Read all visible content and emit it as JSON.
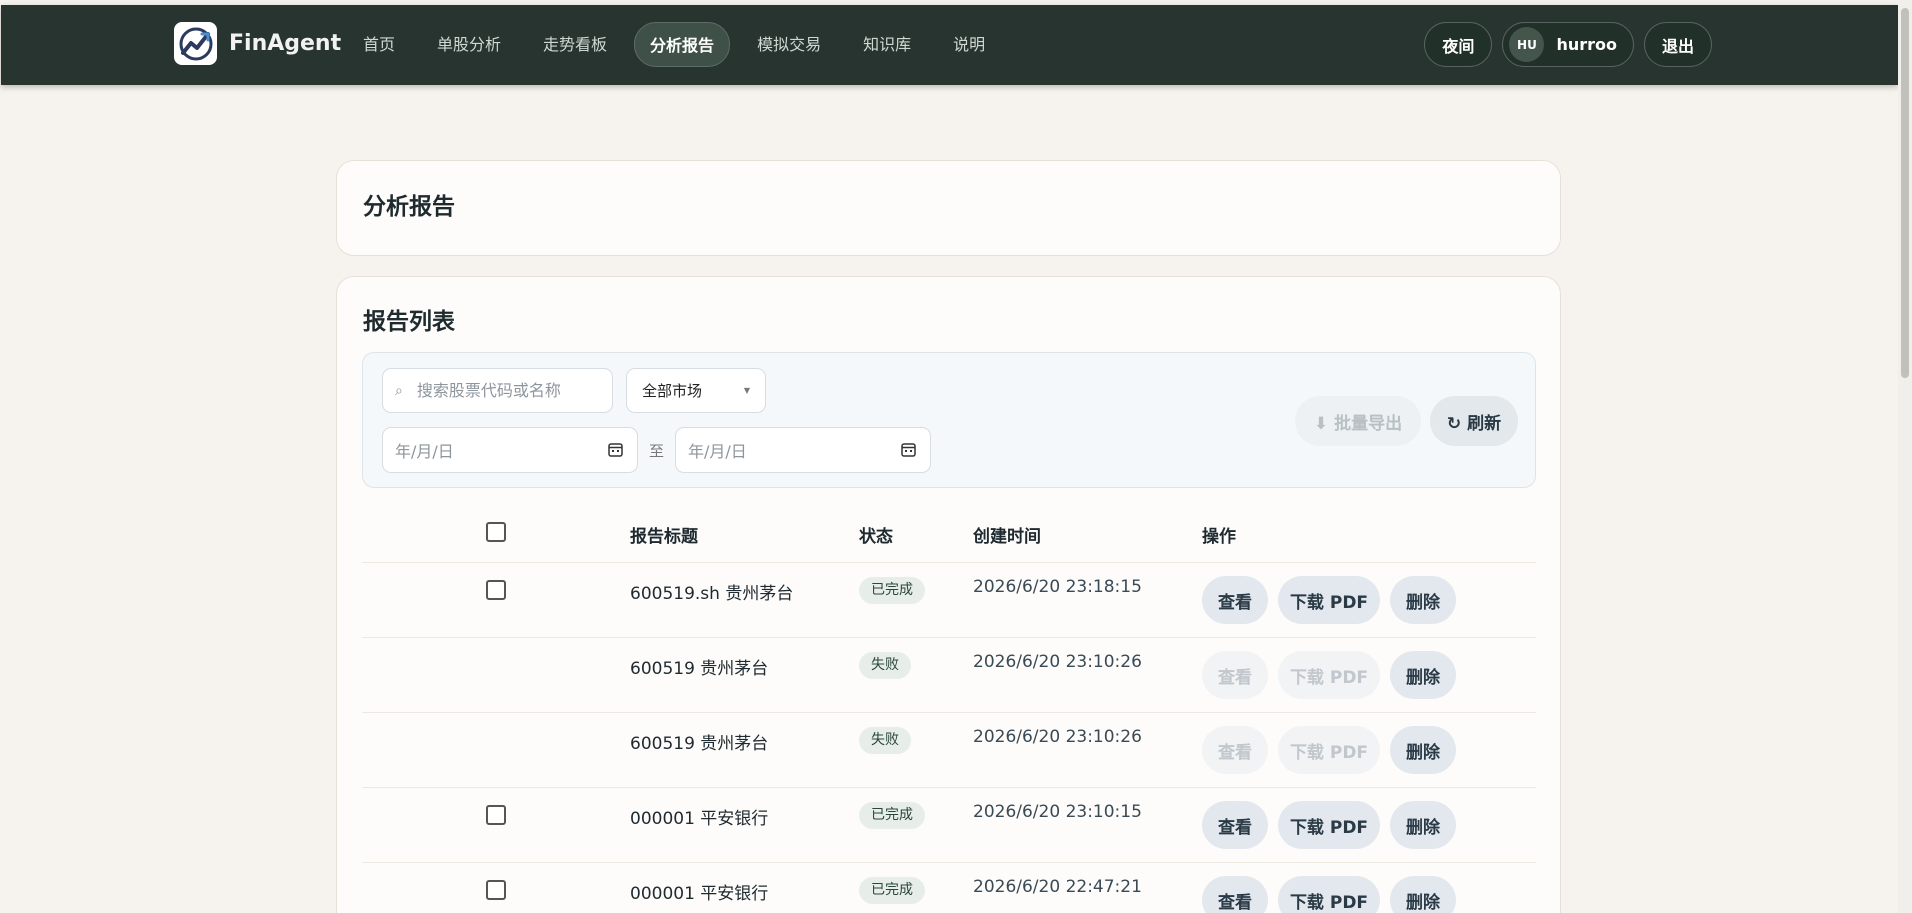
{
  "brand": {
    "name": "FinAgent"
  },
  "nav": {
    "items": [
      {
        "label": "首页",
        "active": false
      },
      {
        "label": "单股分析",
        "active": false
      },
      {
        "label": "走势看板",
        "active": false
      },
      {
        "label": "分析报告",
        "active": true
      },
      {
        "label": "模拟交易",
        "active": false
      },
      {
        "label": "知识库",
        "active": false
      },
      {
        "label": "说明",
        "active": false
      }
    ]
  },
  "user_tools": {
    "night_label": "夜间",
    "avatar_initials": "HU",
    "username": "hurroo",
    "logout_label": "退出"
  },
  "page": {
    "title": "分析报告"
  },
  "list": {
    "title": "报告列表",
    "search_placeholder": "搜索股票代码或名称",
    "market_select": "全部市场",
    "date_from_placeholder": "年/月/日",
    "date_separator": "至",
    "date_to_placeholder": "年/月/日",
    "export_label": "⬇ 批量导出",
    "refresh_label": "↻ 刷新",
    "columns": {
      "title": "报告标题",
      "status": "状态",
      "created": "创建时间",
      "ops": "操作"
    },
    "rows": [
      {
        "title": "600519.sh 贵州茅台",
        "status": "已完成",
        "created": "2026/6/20 23:18:15",
        "checkbox": true,
        "enabled": true
      },
      {
        "title": "600519 贵州茅台",
        "status": "失败",
        "created": "2026/6/20 23:10:26",
        "checkbox": false,
        "enabled": false
      },
      {
        "title": "600519 贵州茅台",
        "status": "失败",
        "created": "2026/6/20 23:10:26",
        "checkbox": false,
        "enabled": false
      },
      {
        "title": "000001 平安银行",
        "status": "已完成",
        "created": "2026/6/20 23:10:15",
        "checkbox": true,
        "enabled": true
      },
      {
        "title": "000001 平安银行",
        "status": "已完成",
        "created": "2026/6/20 22:47:21",
        "checkbox": true,
        "enabled": true
      }
    ],
    "op_labels": {
      "view": "查看",
      "pdf": "下载 PDF",
      "delete": "删除"
    }
  }
}
